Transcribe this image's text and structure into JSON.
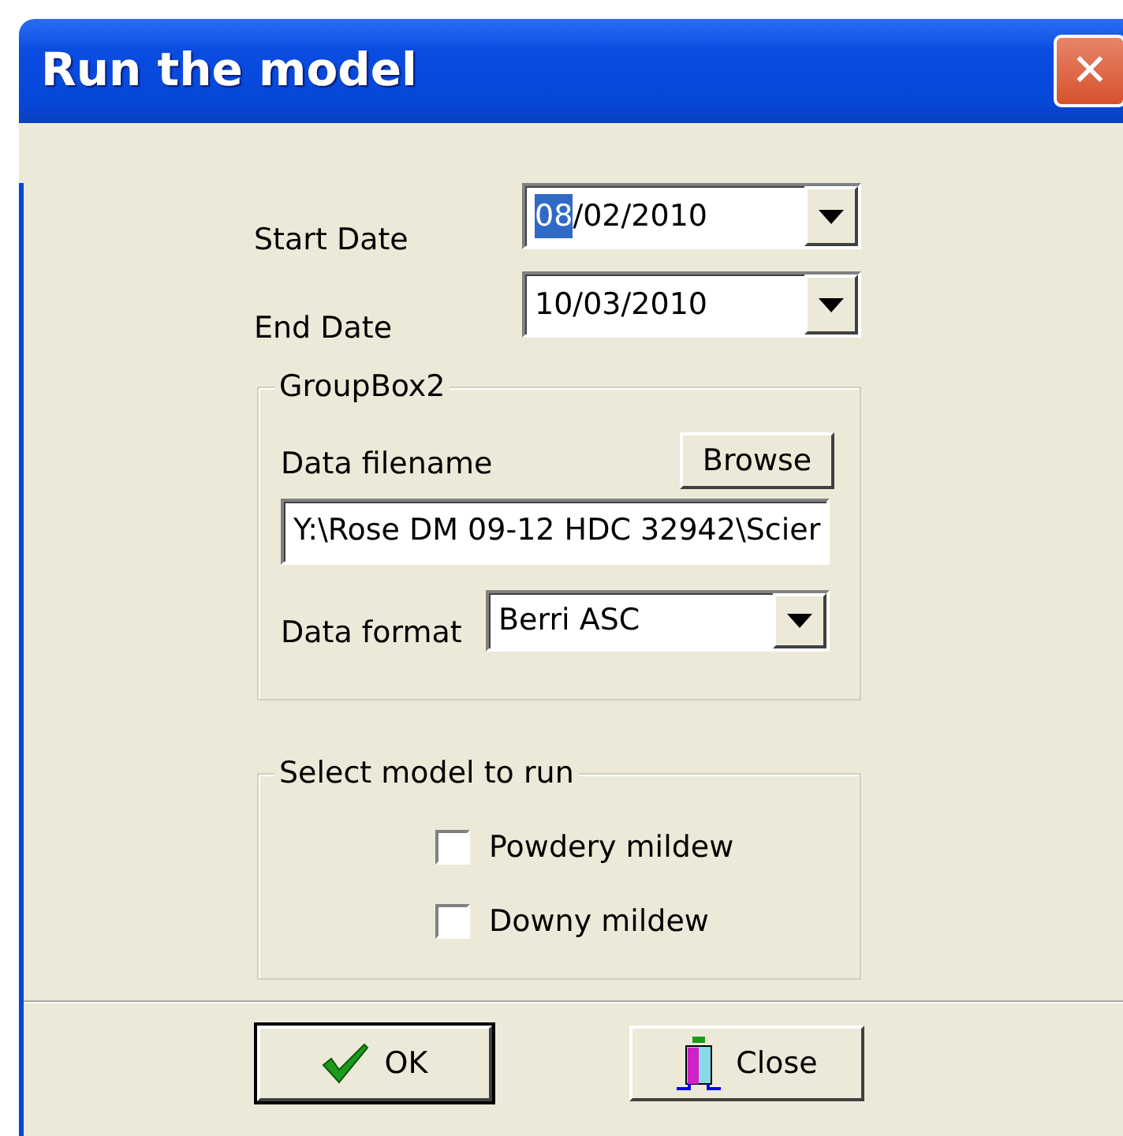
{
  "window": {
    "title": "Run the model",
    "close_glyph": "✕"
  },
  "dates": [
    {
      "label": "Start Date",
      "value_parts": [
        {
          "text": "08",
          "selected": true
        },
        {
          "text": "/02/2010",
          "selected": false
        }
      ]
    },
    {
      "label": "End Date",
      "value_parts": [
        {
          "text": "10/03/2010",
          "selected": false
        }
      ]
    }
  ],
  "data_group": {
    "title": "GroupBox2",
    "filename_label": "Data filename",
    "browse_button": "Browse",
    "filename_value": "Y:\\Rose DM 09-12 HDC 32942\\Scier",
    "format_label": "Data format",
    "format_value": "Berri ASC"
  },
  "model_group": {
    "title": "Select model to run",
    "options": [
      {
        "label": "Powdery mildew",
        "checked": false
      },
      {
        "label": "Downy mildew",
        "checked": false
      }
    ]
  },
  "buttons": [
    {
      "kind": "ok",
      "label": "OK"
    },
    {
      "kind": "close",
      "label": "Close"
    }
  ]
}
